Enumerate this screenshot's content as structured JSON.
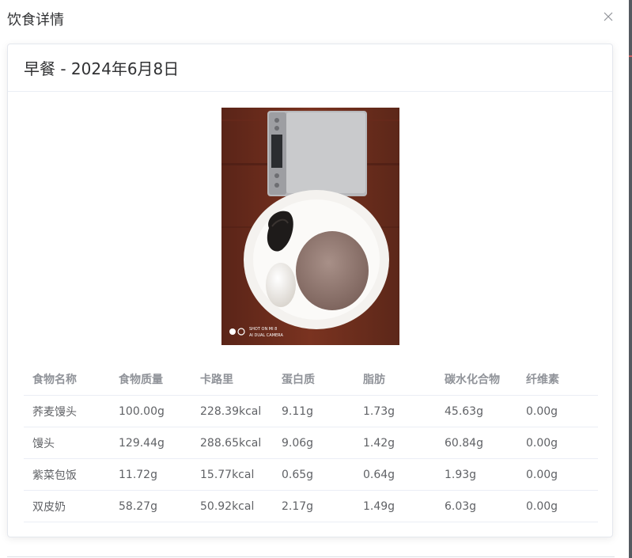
{
  "dialog": {
    "title": "饮食详情",
    "close_icon": "close-icon"
  },
  "card": {
    "title": "早餐 - 2024年6月8日",
    "image": {
      "description_icon": "meal-photo",
      "watermark_line1": "SHOT ON MI 8",
      "watermark_line2": "AI DUAL CAMERA"
    }
  },
  "table": {
    "columns": [
      "食物名称",
      "食物质量",
      "卡路里",
      "蛋白质",
      "脂肪",
      "碳水化合物",
      "纤维素"
    ],
    "rows": [
      [
        "荞麦馒头",
        "100.00g",
        "228.39kcal",
        "9.11g",
        "1.73g",
        "45.63g",
        "0.00g"
      ],
      [
        "馒头",
        "129.44g",
        "288.65kcal",
        "9.06g",
        "1.42g",
        "60.84g",
        "0.00g"
      ],
      [
        "紫菜包饭",
        "11.72g",
        "15.77kcal",
        "0.65g",
        "0.64g",
        "1.93g",
        "0.00g"
      ],
      [
        "双皮奶",
        "58.27g",
        "50.92kcal",
        "2.17g",
        "1.49g",
        "6.03g",
        "0.00g"
      ]
    ]
  },
  "colors": {
    "text_primary": "#303133",
    "text_regular": "#606266",
    "text_secondary": "#909399",
    "border": "#ebeef5"
  }
}
